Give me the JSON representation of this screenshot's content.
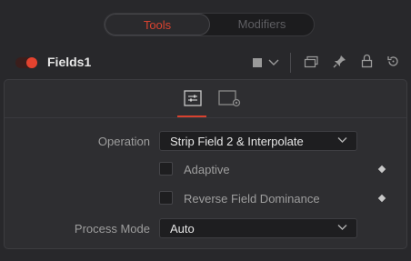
{
  "tabs": {
    "tools": "Tools",
    "modifiers": "Modifiers"
  },
  "header": {
    "node_name": "Fields1",
    "icons": [
      "color-swatch-icon",
      "chevron-down-icon",
      "view-window-icon",
      "pin-icon",
      "lock-icon",
      "reset-icon"
    ]
  },
  "panel": {
    "tab_icons": [
      "controls-icon",
      "settings-icon"
    ],
    "operation": {
      "label": "Operation",
      "value": "Strip Field 2 & Interpolate"
    },
    "adaptive": {
      "label": "Adaptive",
      "checked": false
    },
    "reverse_field": {
      "label": "Reverse Field Dominance",
      "checked": false
    },
    "process_mode": {
      "label": "Process Mode",
      "value": "Auto"
    }
  },
  "colors": {
    "accent": "#d8422f",
    "background": "#28282b",
    "panel": "#2e2e31"
  }
}
